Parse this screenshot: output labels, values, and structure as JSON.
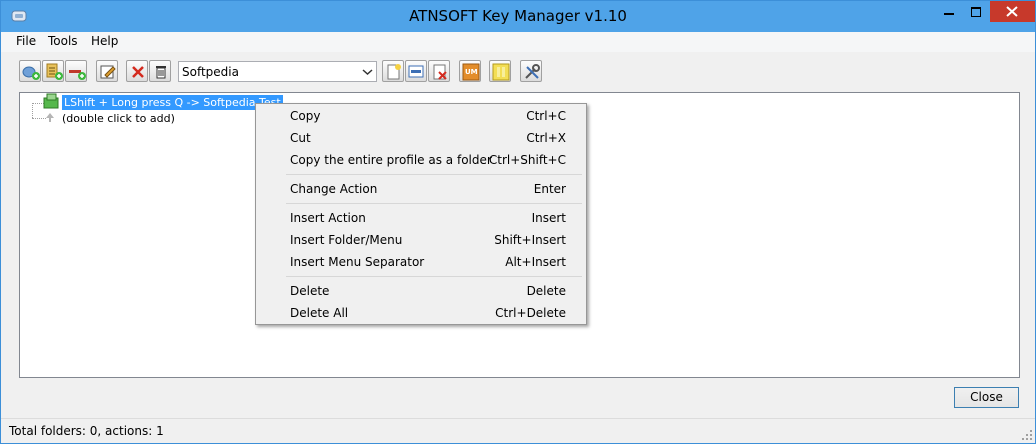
{
  "window": {
    "title": "ATNSOFT Key Manager v1.10"
  },
  "menu": [
    "File",
    "Tools",
    "Help"
  ],
  "toolbar": {
    "profile": "Softpedia",
    "icons": [
      "add-folder-icon",
      "add-file-icon",
      "add-separator-icon",
      "edit-icon",
      "delete-icon",
      "clear-all-icon",
      "new-profile-icon",
      "rename-profile-icon",
      "delete-profile-icon",
      "user-mode-icon",
      "pause-icon",
      "settings-icon"
    ]
  },
  "tree": {
    "selected_node": "LShift + Long press Q -> Softpedia Test",
    "add_node": "(double click to add)"
  },
  "context_menu": {
    "items": [
      {
        "label": "Copy",
        "shortcut": "Ctrl+C"
      },
      {
        "label": "Cut",
        "shortcut": "Ctrl+X"
      },
      {
        "label": "Copy the entire profile as a folder",
        "shortcut": "Ctrl+Shift+C"
      },
      {
        "label": "Change Action",
        "shortcut": "Enter"
      },
      {
        "label": "Insert Action",
        "shortcut": "Insert"
      },
      {
        "label": "Insert Folder/Menu",
        "shortcut": "Shift+Insert"
      },
      {
        "label": "Insert Menu Separator",
        "shortcut": "Alt+Insert"
      },
      {
        "label": "Delete",
        "shortcut": "Delete"
      },
      {
        "label": "Delete All",
        "shortcut": "Ctrl+Delete"
      }
    ]
  },
  "buttons": {
    "close": "Close"
  },
  "status": {
    "text": "Total folders: 0, actions: 1"
  }
}
